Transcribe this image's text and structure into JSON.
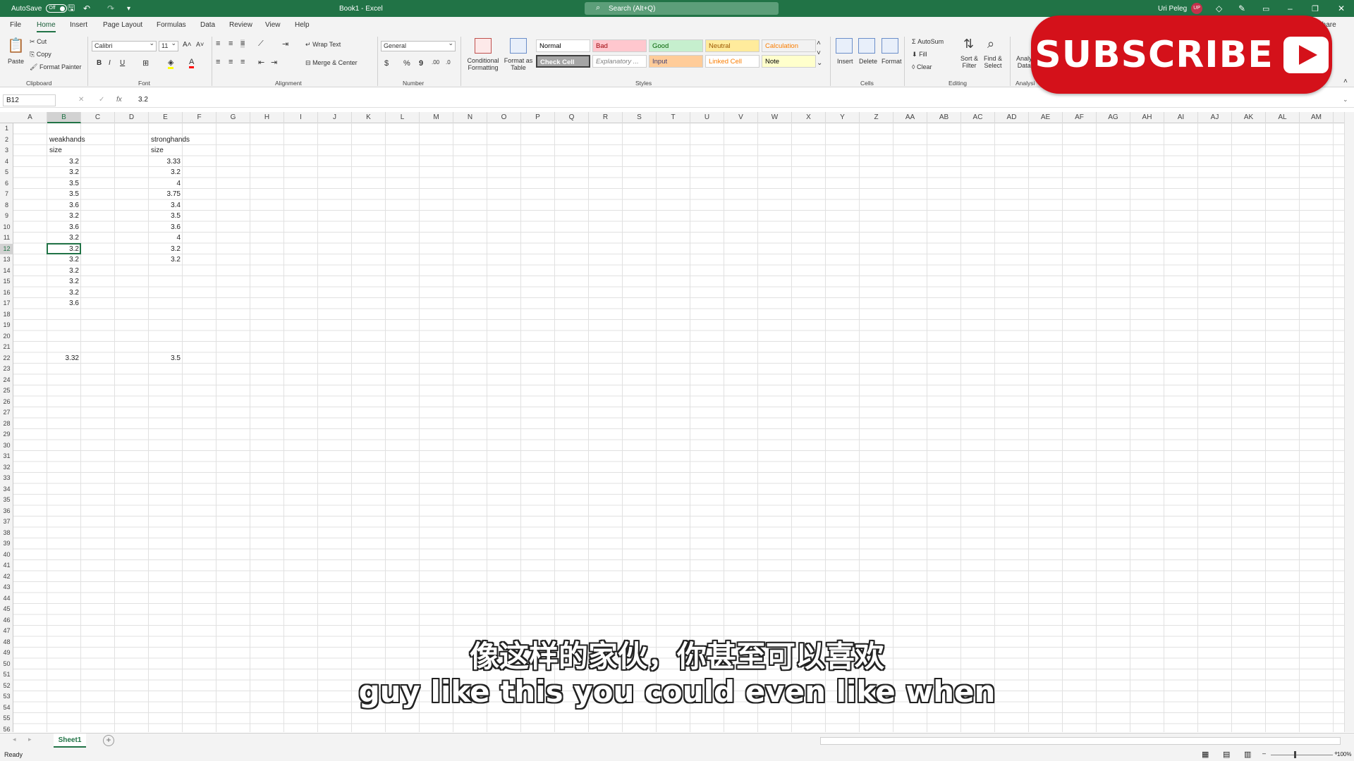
{
  "titlebar": {
    "autosave_label": "AutoSave",
    "autosave_state": "Off",
    "doc_title": "Book1 - Excel",
    "search_placeholder": "Search (Alt+Q)",
    "user_name": "Uri Peleg",
    "user_initials": "UP"
  },
  "menu": [
    "File",
    "Home",
    "Insert",
    "Page Layout",
    "Formulas",
    "Data",
    "Review",
    "View",
    "Help"
  ],
  "share_label": "Share",
  "ribbon": {
    "clipboard": {
      "paste": "Paste",
      "cut": "Cut",
      "copy": "Copy",
      "format_painter": "Format Painter",
      "label": "Clipboard"
    },
    "font": {
      "family": "Calibri",
      "size": "11",
      "label": "Font"
    },
    "alignment": {
      "wrap_text": "Wrap Text",
      "merge_center": "Merge & Center",
      "label": "Alignment"
    },
    "number": {
      "format": "General",
      "label": "Number"
    },
    "styles": {
      "conditional": "Conditional",
      "formatting": "Formatting",
      "format_as": "Format as",
      "table": "Table",
      "cells": [
        {
          "name": "Normal",
          "bg": "#ffffff",
          "fg": "#000000"
        },
        {
          "name": "Bad",
          "bg": "#ffc7ce",
          "fg": "#9c0006"
        },
        {
          "name": "Good",
          "bg": "#c6efce",
          "fg": "#006100"
        },
        {
          "name": "Neutral",
          "bg": "#ffeb9c",
          "fg": "#9c5700"
        },
        {
          "name": "Calculation",
          "bg": "#f2f2f2",
          "fg": "#fa7d00"
        },
        {
          "name": "Check Cell",
          "bg": "#a5a5a5",
          "fg": "#ffffff"
        },
        {
          "name": "Explanatory ...",
          "bg": "#ffffff",
          "fg": "#7f7f7f"
        },
        {
          "name": "Input",
          "bg": "#ffcc99",
          "fg": "#3f3f76"
        },
        {
          "name": "Linked Cell",
          "bg": "#ffffff",
          "fg": "#fa7d00"
        },
        {
          "name": "Note",
          "bg": "#ffffcc",
          "fg": "#000000"
        }
      ],
      "label": "Styles"
    },
    "cells": {
      "insert": "Insert",
      "delete": "Delete",
      "format": "Format",
      "label": "Cells"
    },
    "editing": {
      "autosum": "AutoSum",
      "fill": "Fill",
      "clear": "Clear",
      "sort_filter_1": "Sort &",
      "sort_filter_2": "Filter",
      "find_select_1": "Find &",
      "find_select_2": "Select",
      "label": "Editing"
    },
    "analysis": {
      "label_1": "Analy",
      "label_2": "Data",
      "group": "Analysi"
    }
  },
  "formula_bar": {
    "name_box": "B12",
    "fx": "fx",
    "value": "3.2"
  },
  "columns": [
    "A",
    "B",
    "C",
    "D",
    "E",
    "F",
    "G",
    "H",
    "I",
    "J",
    "K",
    "L",
    "M",
    "N",
    "O",
    "P",
    "Q",
    "R",
    "S",
    "T",
    "U",
    "V",
    "W",
    "X",
    "Y",
    "Z",
    "AA",
    "AB",
    "AC",
    "AD",
    "AE",
    "AF",
    "AG",
    "AH",
    "AI",
    "AJ",
    "AK",
    "AL",
    "AM"
  ],
  "selected_column": "B",
  "selected_row": 12,
  "row_count": 56,
  "cells": [
    {
      "col": 1,
      "row": 2,
      "v": "weakhands",
      "num": false
    },
    {
      "col": 1,
      "row": 3,
      "v": "size",
      "num": false
    },
    {
      "col": 1,
      "row": 4,
      "v": "3.2",
      "num": true
    },
    {
      "col": 1,
      "row": 5,
      "v": "3.2",
      "num": true
    },
    {
      "col": 1,
      "row": 6,
      "v": "3.5",
      "num": true
    },
    {
      "col": 1,
      "row": 7,
      "v": "3.5",
      "num": true
    },
    {
      "col": 1,
      "row": 8,
      "v": "3.6",
      "num": true
    },
    {
      "col": 1,
      "row": 9,
      "v": "3.2",
      "num": true
    },
    {
      "col": 1,
      "row": 10,
      "v": "3.6",
      "num": true
    },
    {
      "col": 1,
      "row": 11,
      "v": "3.2",
      "num": true
    },
    {
      "col": 1,
      "row": 12,
      "v": "3.2",
      "num": true
    },
    {
      "col": 1,
      "row": 13,
      "v": "3.2",
      "num": true
    },
    {
      "col": 1,
      "row": 14,
      "v": "3.2",
      "num": true
    },
    {
      "col": 1,
      "row": 15,
      "v": "3.2",
      "num": true
    },
    {
      "col": 1,
      "row": 16,
      "v": "3.2",
      "num": true
    },
    {
      "col": 1,
      "row": 17,
      "v": "3.6",
      "num": true
    },
    {
      "col": 1,
      "row": 22,
      "v": "3.32",
      "num": true
    },
    {
      "col": 4,
      "row": 2,
      "v": "stronghands",
      "num": false
    },
    {
      "col": 4,
      "row": 3,
      "v": "size",
      "num": false
    },
    {
      "col": 4,
      "row": 4,
      "v": "3.33",
      "num": true
    },
    {
      "col": 4,
      "row": 5,
      "v": "3.2",
      "num": true
    },
    {
      "col": 4,
      "row": 6,
      "v": "4",
      "num": true
    },
    {
      "col": 4,
      "row": 7,
      "v": "3.75",
      "num": true
    },
    {
      "col": 4,
      "row": 8,
      "v": "3.4",
      "num": true
    },
    {
      "col": 4,
      "row": 9,
      "v": "3.5",
      "num": true
    },
    {
      "col": 4,
      "row": 10,
      "v": "3.6",
      "num": true
    },
    {
      "col": 4,
      "row": 11,
      "v": "4",
      "num": true
    },
    {
      "col": 4,
      "row": 12,
      "v": "3.2",
      "num": true
    },
    {
      "col": 4,
      "row": 13,
      "v": "3.2",
      "num": true
    },
    {
      "col": 4,
      "row": 22,
      "v": "3.5",
      "num": true
    }
  ],
  "sheet_tab": "Sheet1",
  "status": {
    "ready": "Ready",
    "zoom": "100%"
  },
  "overlay": {
    "subscribe": "SUBSCRIBE"
  },
  "subtitles": {
    "zh": "像这样的家伙，你甚至可以喜欢",
    "en": "guy like this you could even like when"
  }
}
